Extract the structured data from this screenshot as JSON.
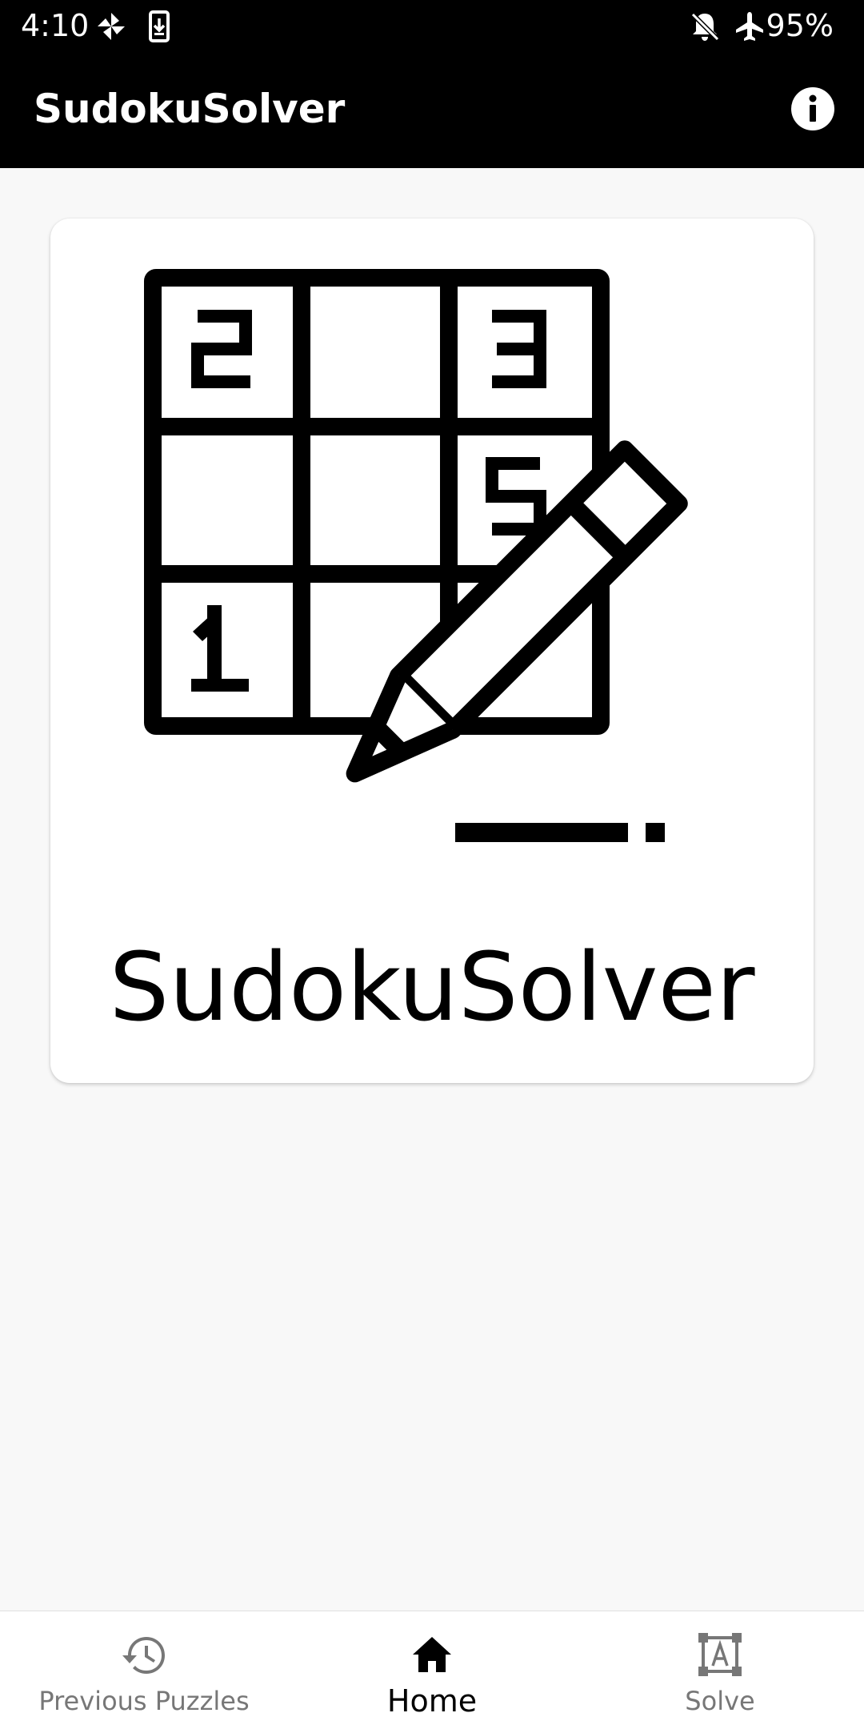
{
  "status_bar": {
    "time": "4:10",
    "battery": "95%",
    "icons": [
      "pinwheel-icon",
      "download-icon",
      "bell-off-icon",
      "airplane-icon"
    ]
  },
  "app_bar": {
    "title": "SudokuSolver",
    "info_icon": "info-icon"
  },
  "card": {
    "title": "SudokuSolver",
    "logo_icon": "sudoku-grid-pencil-icon",
    "grid_digits": [
      "2",
      "3",
      "5",
      "1"
    ]
  },
  "bottom_nav": {
    "items": [
      {
        "label": "Previous Puzzles",
        "icon": "history-icon",
        "active": false
      },
      {
        "label": "Home",
        "icon": "home-icon",
        "active": true
      },
      {
        "label": "Solve",
        "icon": "scan-text-icon",
        "active": false
      }
    ]
  },
  "colors": {
    "bar_background": "#000000",
    "page_background": "#f8f8f8",
    "card_background": "#ffffff",
    "nav_active": "#000000",
    "nav_inactive": "#777777"
  }
}
